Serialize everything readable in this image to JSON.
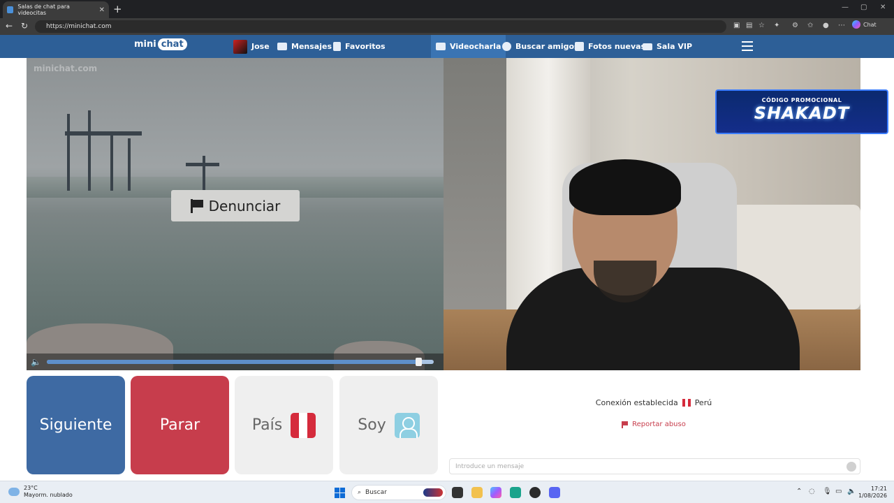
{
  "browser": {
    "tab_title": "Salas de chat para videocitas",
    "tab_close": "✕",
    "new_tab": "+",
    "url": "https://minichat.com",
    "chat_label": "Chat",
    "win_min": "—",
    "win_max": "▢",
    "win_close": "✕"
  },
  "site": {
    "logo_left": "mini",
    "logo_right": "chat",
    "nav": {
      "user": "Jose",
      "messages": "Mensajes",
      "favorites": "Favoritos",
      "videochat": "Videocharla",
      "find_friends": "Buscar amigos",
      "new_photos": "Fotos nuevas",
      "vip": "Sala VIP"
    },
    "watermark": "minichat.com",
    "report_button": "Denunciar",
    "volume_level": 0.96,
    "promo": {
      "label": "CÓDIGO PROMOCIONAL",
      "code": "SHAKADT"
    },
    "actions": {
      "next": "Siguiente",
      "stop": "Parar",
      "country": "País",
      "me": "Soy"
    },
    "status": {
      "text": "Conexión establecida",
      "country": "Perú"
    },
    "report_abuse": "Reportar abuso",
    "message_placeholder": "Introduce un mensaje"
  },
  "taskbar": {
    "temp": "23°C",
    "weather": "Mayorm. nublado",
    "search": "Buscar",
    "time": "17:21",
    "date": "1/08/2026"
  },
  "colors": {
    "nav_bg": "#2d5f97",
    "next_btn": "#3e6aa3",
    "stop_btn": "#c73d4c",
    "peru_red": "#d52b3c"
  }
}
